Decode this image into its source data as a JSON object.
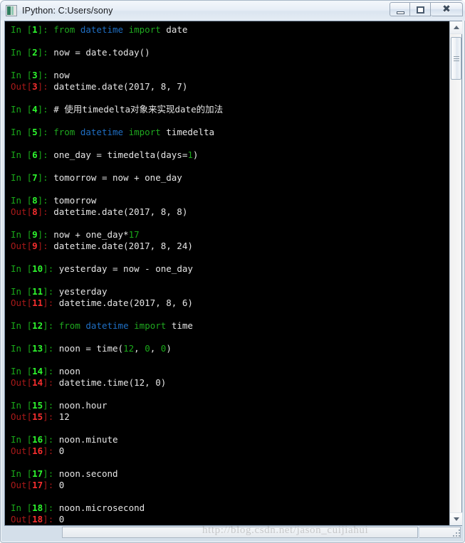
{
  "window": {
    "title": "IPython: C:Users/sony",
    "icon": "ipython-icon",
    "controls": {
      "minimize": "minimize-button",
      "restore": "restore-button",
      "close": "✖"
    }
  },
  "colors": {
    "background": "#000000",
    "prompt_in": "#19a819",
    "prompt_in_number": "#2ef72e",
    "prompt_out": "#a81919",
    "prompt_out_number": "#f72e2e",
    "keyword": "#1fa81f",
    "module": "#1f6fc4",
    "text": "#e6e6e6",
    "number": "#19a819",
    "titlebar": "#e7eef6"
  },
  "console": {
    "lines": [
      {
        "type": "in",
        "n": "1",
        "segs": [
          {
            "t": "from",
            "c": "kw"
          },
          {
            "t": " ",
            "c": "plain"
          },
          {
            "t": "datetime",
            "c": "mod"
          },
          {
            "t": " ",
            "c": "plain"
          },
          {
            "t": "import",
            "c": "kw"
          },
          {
            "t": " date",
            "c": "plain"
          }
        ]
      },
      {
        "type": "blank"
      },
      {
        "type": "in",
        "n": "2",
        "segs": [
          {
            "t": "now = date.today()",
            "c": "plain"
          }
        ]
      },
      {
        "type": "blank"
      },
      {
        "type": "in",
        "n": "3",
        "segs": [
          {
            "t": "now",
            "c": "plain"
          }
        ]
      },
      {
        "type": "out",
        "n": "3",
        "segs": [
          {
            "t": "datetime.date(2017, 8, 7)",
            "c": "outval"
          }
        ]
      },
      {
        "type": "blank"
      },
      {
        "type": "in",
        "n": "4",
        "segs": [
          {
            "t": "# 使用timedelta对象来实现date的加法",
            "c": "comment"
          }
        ]
      },
      {
        "type": "blank"
      },
      {
        "type": "in",
        "n": "5",
        "segs": [
          {
            "t": "from",
            "c": "kw"
          },
          {
            "t": " ",
            "c": "plain"
          },
          {
            "t": "datetime",
            "c": "mod"
          },
          {
            "t": " ",
            "c": "plain"
          },
          {
            "t": "import",
            "c": "kw"
          },
          {
            "t": " timedelta",
            "c": "plain"
          }
        ]
      },
      {
        "type": "blank"
      },
      {
        "type": "in",
        "n": "6",
        "segs": [
          {
            "t": "one_day = timedelta(days=",
            "c": "plain"
          },
          {
            "t": "1",
            "c": "num"
          },
          {
            "t": ")",
            "c": "plain"
          }
        ]
      },
      {
        "type": "blank"
      },
      {
        "type": "in",
        "n": "7",
        "segs": [
          {
            "t": "tomorrow = now + one_day",
            "c": "plain"
          }
        ]
      },
      {
        "type": "blank"
      },
      {
        "type": "in",
        "n": "8",
        "segs": [
          {
            "t": "tomorrow",
            "c": "plain"
          }
        ]
      },
      {
        "type": "out",
        "n": "8",
        "segs": [
          {
            "t": "datetime.date(2017, 8, 8)",
            "c": "outval"
          }
        ]
      },
      {
        "type": "blank"
      },
      {
        "type": "in",
        "n": "9",
        "segs": [
          {
            "t": "now + one_day*",
            "c": "plain"
          },
          {
            "t": "17",
            "c": "num"
          }
        ]
      },
      {
        "type": "out",
        "n": "9",
        "segs": [
          {
            "t": "datetime.date(2017, 8, 24)",
            "c": "outval"
          }
        ]
      },
      {
        "type": "blank"
      },
      {
        "type": "in",
        "n": "10",
        "segs": [
          {
            "t": "yesterday = now - one_day",
            "c": "plain"
          }
        ]
      },
      {
        "type": "blank"
      },
      {
        "type": "in",
        "n": "11",
        "segs": [
          {
            "t": "yesterday",
            "c": "plain"
          }
        ]
      },
      {
        "type": "out",
        "n": "11",
        "segs": [
          {
            "t": "datetime.date(2017, 8, 6)",
            "c": "outval"
          }
        ]
      },
      {
        "type": "blank"
      },
      {
        "type": "in",
        "n": "12",
        "segs": [
          {
            "t": "from",
            "c": "kw"
          },
          {
            "t": " ",
            "c": "plain"
          },
          {
            "t": "datetime",
            "c": "mod"
          },
          {
            "t": " ",
            "c": "plain"
          },
          {
            "t": "import",
            "c": "kw"
          },
          {
            "t": " time",
            "c": "plain"
          }
        ]
      },
      {
        "type": "blank"
      },
      {
        "type": "in",
        "n": "13",
        "segs": [
          {
            "t": "noon = time(",
            "c": "plain"
          },
          {
            "t": "12",
            "c": "num"
          },
          {
            "t": ", ",
            "c": "plain"
          },
          {
            "t": "0",
            "c": "num"
          },
          {
            "t": ", ",
            "c": "plain"
          },
          {
            "t": "0",
            "c": "num"
          },
          {
            "t": ")",
            "c": "plain"
          }
        ]
      },
      {
        "type": "blank"
      },
      {
        "type": "in",
        "n": "14",
        "segs": [
          {
            "t": "noon",
            "c": "plain"
          }
        ]
      },
      {
        "type": "out",
        "n": "14",
        "segs": [
          {
            "t": "datetime.time(12, 0)",
            "c": "outval"
          }
        ]
      },
      {
        "type": "blank"
      },
      {
        "type": "in",
        "n": "15",
        "segs": [
          {
            "t": "noon.hour",
            "c": "plain"
          }
        ]
      },
      {
        "type": "out",
        "n": "15",
        "segs": [
          {
            "t": "12",
            "c": "outval"
          }
        ]
      },
      {
        "type": "blank"
      },
      {
        "type": "in",
        "n": "16",
        "segs": [
          {
            "t": "noon.minute",
            "c": "plain"
          }
        ]
      },
      {
        "type": "out",
        "n": "16",
        "segs": [
          {
            "t": "0",
            "c": "outval"
          }
        ]
      },
      {
        "type": "blank"
      },
      {
        "type": "in",
        "n": "17",
        "segs": [
          {
            "t": "noon.second",
            "c": "plain"
          }
        ]
      },
      {
        "type": "out",
        "n": "17",
        "segs": [
          {
            "t": "0",
            "c": "outval"
          }
        ]
      },
      {
        "type": "blank"
      },
      {
        "type": "in",
        "n": "18",
        "segs": [
          {
            "t": "noon.microsecond",
            "c": "plain"
          }
        ]
      },
      {
        "type": "out",
        "n": "18",
        "segs": [
          {
            "t": "0",
            "c": "outval"
          }
        ]
      }
    ]
  },
  "scrollbar": {
    "up_arrow": "scroll-up-arrow",
    "down_arrow": "scroll-down-arrow",
    "thumb": "scroll-thumb"
  },
  "watermark": {
    "text": "http://blog.csdn.net/jason_cuijiahui"
  }
}
